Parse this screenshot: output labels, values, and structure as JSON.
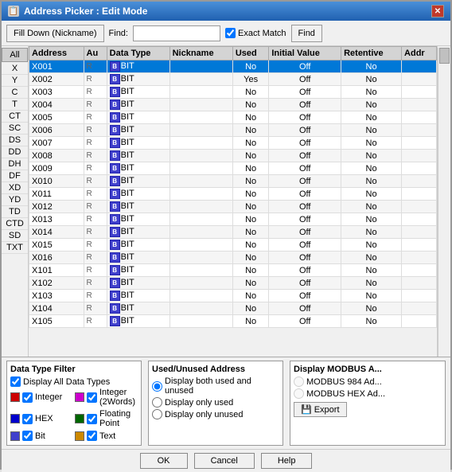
{
  "window": {
    "title": "Address Picker : Edit Mode",
    "icon": "📋"
  },
  "toolbar": {
    "fill_down_btn": "Fill Down (Nickname)",
    "find_label": "Find:",
    "find_placeholder": "",
    "exact_match_label": "Exact Match",
    "find_btn": "Find"
  },
  "left_nav": {
    "all_label": "All",
    "items": [
      "X",
      "Y",
      "C",
      "T",
      "CT",
      "SC",
      "DS",
      "DD",
      "DH",
      "DF",
      "XD",
      "YD",
      "TD",
      "CTD",
      "SD",
      "TXT"
    ]
  },
  "table": {
    "headers": [
      "Address",
      "Au",
      "Data Type",
      "Nickname",
      "Used",
      "Initial Value",
      "Retentive",
      "Addr"
    ],
    "rows": [
      {
        "address": "X001",
        "rw": "R",
        "type": "BIT",
        "nickname": "",
        "used": "No",
        "initial": "Off",
        "retentive": "No",
        "selected": true
      },
      {
        "address": "X002",
        "rw": "R",
        "type": "BIT",
        "nickname": "",
        "used": "Yes",
        "initial": "Off",
        "retentive": "No",
        "selected": false
      },
      {
        "address": "X003",
        "rw": "R",
        "type": "BIT",
        "nickname": "",
        "used": "No",
        "initial": "Off",
        "retentive": "No",
        "selected": false
      },
      {
        "address": "X004",
        "rw": "R",
        "type": "BIT",
        "nickname": "",
        "used": "No",
        "initial": "Off",
        "retentive": "No",
        "selected": false
      },
      {
        "address": "X005",
        "rw": "R",
        "type": "BIT",
        "nickname": "",
        "used": "No",
        "initial": "Off",
        "retentive": "No",
        "selected": false
      },
      {
        "address": "X006",
        "rw": "R",
        "type": "BIT",
        "nickname": "",
        "used": "No",
        "initial": "Off",
        "retentive": "No",
        "selected": false
      },
      {
        "address": "X007",
        "rw": "R",
        "type": "BIT",
        "nickname": "",
        "used": "No",
        "initial": "Off",
        "retentive": "No",
        "selected": false
      },
      {
        "address": "X008",
        "rw": "R",
        "type": "BIT",
        "nickname": "",
        "used": "No",
        "initial": "Off",
        "retentive": "No",
        "selected": false
      },
      {
        "address": "X009",
        "rw": "R",
        "type": "BIT",
        "nickname": "",
        "used": "No",
        "initial": "Off",
        "retentive": "No",
        "selected": false
      },
      {
        "address": "X010",
        "rw": "R",
        "type": "BIT",
        "nickname": "",
        "used": "No",
        "initial": "Off",
        "retentive": "No",
        "selected": false
      },
      {
        "address": "X011",
        "rw": "R",
        "type": "BIT",
        "nickname": "",
        "used": "No",
        "initial": "Off",
        "retentive": "No",
        "selected": false
      },
      {
        "address": "X012",
        "rw": "R",
        "type": "BIT",
        "nickname": "",
        "used": "No",
        "initial": "Off",
        "retentive": "No",
        "selected": false
      },
      {
        "address": "X013",
        "rw": "R",
        "type": "BIT",
        "nickname": "",
        "used": "No",
        "initial": "Off",
        "retentive": "No",
        "selected": false
      },
      {
        "address": "X014",
        "rw": "R",
        "type": "BIT",
        "nickname": "",
        "used": "No",
        "initial": "Off",
        "retentive": "No",
        "selected": false
      },
      {
        "address": "X015",
        "rw": "R",
        "type": "BIT",
        "nickname": "",
        "used": "No",
        "initial": "Off",
        "retentive": "No",
        "selected": false
      },
      {
        "address": "X016",
        "rw": "R",
        "type": "BIT",
        "nickname": "",
        "used": "No",
        "initial": "Off",
        "retentive": "No",
        "selected": false
      },
      {
        "address": "X101",
        "rw": "R",
        "type": "BIT",
        "nickname": "",
        "used": "No",
        "initial": "Off",
        "retentive": "No",
        "selected": false
      },
      {
        "address": "X102",
        "rw": "R",
        "type": "BIT",
        "nickname": "",
        "used": "No",
        "initial": "Off",
        "retentive": "No",
        "selected": false
      },
      {
        "address": "X103",
        "rw": "R",
        "type": "BIT",
        "nickname": "",
        "used": "No",
        "initial": "Off",
        "retentive": "No",
        "selected": false
      },
      {
        "address": "X104",
        "rw": "R",
        "type": "BIT",
        "nickname": "",
        "used": "No",
        "initial": "Off",
        "retentive": "No",
        "selected": false
      },
      {
        "address": "X105",
        "rw": "R",
        "type": "BIT",
        "nickname": "",
        "used": "No",
        "initial": "Off",
        "retentive": "No",
        "selected": false
      }
    ]
  },
  "data_type_filter": {
    "title": "Data Type Filter",
    "display_all_label": "Display All Data Types",
    "types": [
      {
        "label": "Integer",
        "color": "int",
        "checked": true
      },
      {
        "label": "HEX",
        "color": "hex",
        "checked": true
      },
      {
        "label": "Bit",
        "color": "bit",
        "checked": true
      },
      {
        "label": "Integer (2Words)",
        "color": "int2",
        "checked": true
      },
      {
        "label": "Floating Point",
        "color": "float",
        "checked": true
      },
      {
        "label": "Text",
        "color": "text",
        "checked": true
      }
    ]
  },
  "used_filter": {
    "title": "Used/Unused Address",
    "options": [
      {
        "label": "Display both used and unused",
        "value": "both",
        "checked": true
      },
      {
        "label": "Display only used",
        "value": "used",
        "checked": false
      },
      {
        "label": "Display only unused",
        "value": "unused",
        "checked": false
      }
    ]
  },
  "modbus_filter": {
    "title": "Display MODBUS A...",
    "options": [
      {
        "label": "MODBUS 984 Ad...",
        "checked": false
      },
      {
        "label": "MODBUS HEX Ad...",
        "checked": false
      }
    ],
    "export_btn": "Export"
  },
  "buttons": {
    "ok": "OK",
    "cancel": "Cancel",
    "help": "Help"
  }
}
